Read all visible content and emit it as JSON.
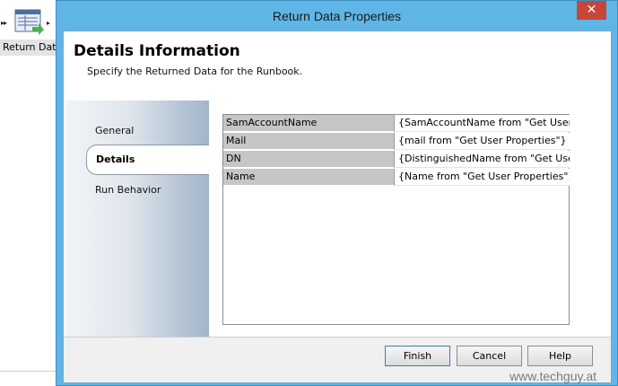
{
  "canvas": {
    "activity_label": "Return Data",
    "activity_icon": "return-data-icon"
  },
  "window": {
    "title": "Return Data Properties",
    "close_glyph": "✕"
  },
  "header": {
    "title": "Details Information",
    "subtitle": "Specify the Returned Data for the Runbook."
  },
  "nav": {
    "items": [
      {
        "label": "General"
      },
      {
        "label": "Details"
      },
      {
        "label": "Run Behavior"
      }
    ],
    "selected": "Details"
  },
  "grid": {
    "rows": [
      {
        "name": "SamAccountName",
        "value": "{SamAccountName from \"Get User Properties\"}"
      },
      {
        "name": "Mail",
        "value": "{mail from \"Get User Properties\"}"
      },
      {
        "name": "DN",
        "value": "{DistinguishedName from \"Get User Properties\"}"
      },
      {
        "name": "Name",
        "value": "{Name from \"Get User Properties\"}"
      }
    ]
  },
  "footer": {
    "finish_label": "Finish",
    "cancel_label": "Cancel",
    "help_label": "Help"
  },
  "watermark": "www.techguy.at",
  "colors": {
    "window_frame": "#5fb6e6",
    "close_button": "#c7463a",
    "grid_name_cell": "#c6c6c6"
  }
}
